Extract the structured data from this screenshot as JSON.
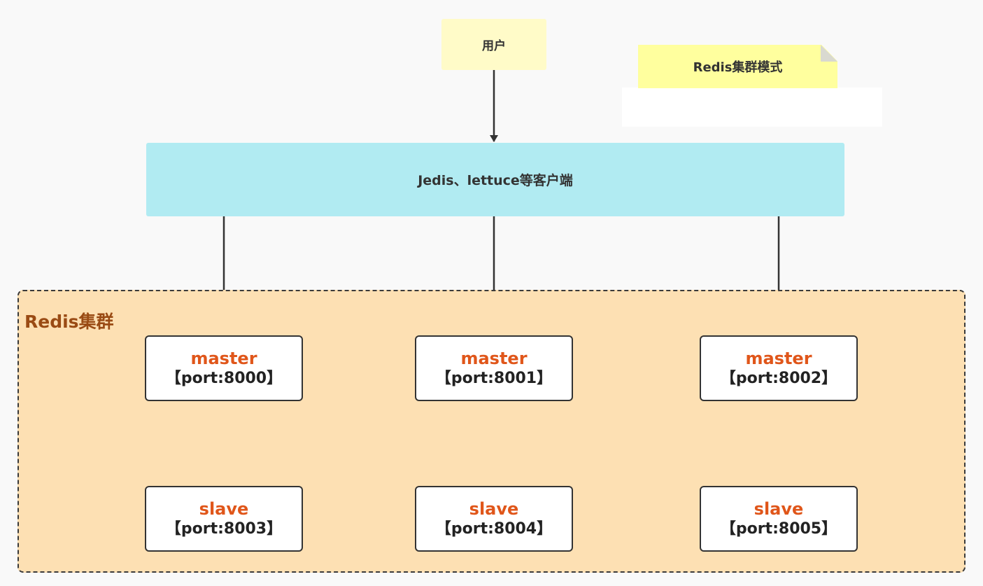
{
  "user": {
    "label": "用户"
  },
  "note": {
    "title": "Redis集群模式"
  },
  "client": {
    "label": "Jedis、lettuce等客户端"
  },
  "cluster": {
    "label": "Redis集群",
    "masters": [
      {
        "role": "master",
        "port": "【port:8000】"
      },
      {
        "role": "master",
        "port": "【port:8001】"
      },
      {
        "role": "master",
        "port": "【port:8002】"
      }
    ],
    "slaves": [
      {
        "role": "slave",
        "port": "【port:8003】"
      },
      {
        "role": "slave",
        "port": "【port:8004】"
      },
      {
        "role": "slave",
        "port": "【port:8005】"
      }
    ]
  },
  "colors": {
    "user_fill": "#fffbc8",
    "note_fill": "#ffff9e",
    "client_fill": "#b1ebf2",
    "cluster_fill": "#fde0b3",
    "cluster_label": "#9a4b14",
    "role_text": "#e0561a"
  }
}
